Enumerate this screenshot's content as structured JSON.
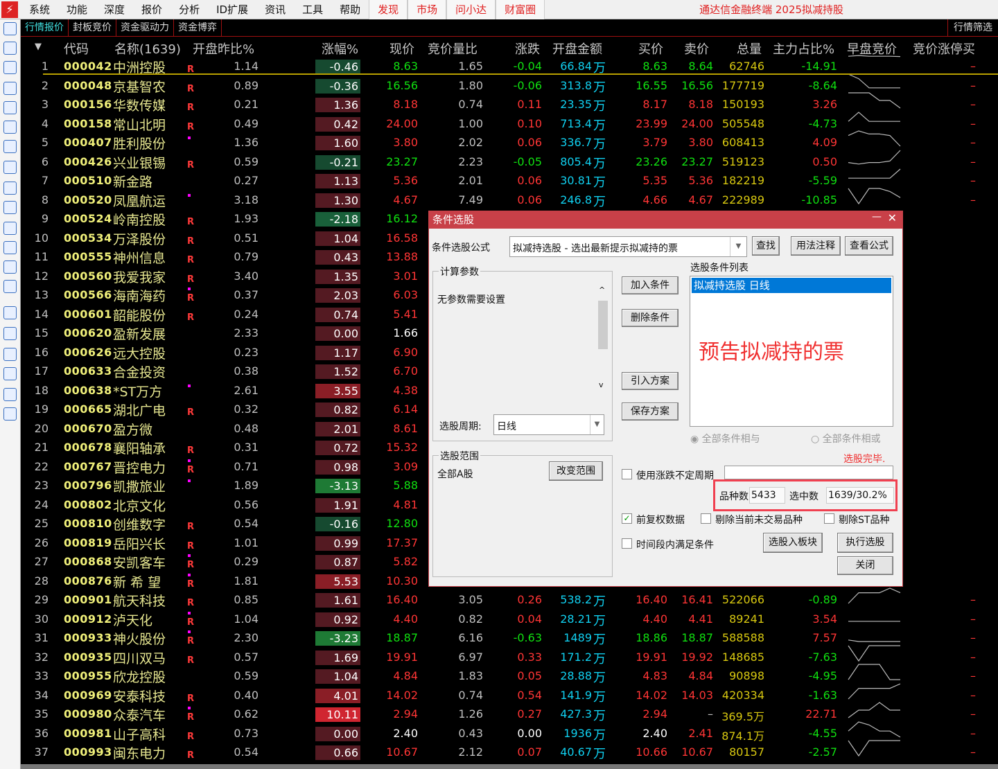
{
  "menubar": {
    "items": [
      "系统",
      "功能",
      "深度",
      "报价",
      "分析",
      "ID扩展",
      "资讯",
      "工具",
      "帮助"
    ],
    "right_items": [
      "发现",
      "市场",
      "问小达",
      "财富圈"
    ],
    "title": "通达信金融终端  2025拟减持股"
  },
  "tabs": {
    "items": [
      "行情报价",
      "封板竞价",
      "资金驱动力",
      "资金博弈"
    ],
    "filter": "行情筛选"
  },
  "toolbar_icons": [
    "back-arrow-icon",
    "up-arrow-icon",
    "down-arrow-icon",
    "quote-list-icon",
    "grid-icon",
    "line-chart-icon",
    "kline-icon",
    "report-icon",
    "f10-icon",
    "board-icon",
    "notes-icon",
    "f12-icon",
    "formula-icon",
    "circle-icon",
    "folder-icon",
    "sort-icon",
    "scatter-icon",
    "export-icon",
    "printer-icon",
    "gear-icon"
  ],
  "headers": [
    "代码",
    "名称(1639)",
    "开盘昨比%",
    "涨幅%",
    "现价",
    "竞价量比",
    "涨跌",
    "开盘金额",
    "买价",
    "卖价",
    "总量",
    "主力占比%",
    "早盘竞价",
    "竞价涨停买"
  ],
  "colors": {
    "up": "#ff3535",
    "down": "#10e010",
    "accent": "#c84048"
  },
  "rows": [
    [
      "1",
      "000042",
      "中洲控股",
      "R",
      "1.14",
      "-0.46",
      "8.63",
      "1.65",
      "-0.04",
      "66.84",
      "8.63",
      "8.64",
      "62746",
      "-14.91",
      [
        0.1,
        0.05,
        0.1,
        0.1,
        0.1,
        0.12
      ]
    ],
    [
      "2",
      "000048",
      "京基智农",
      "R",
      "0.89",
      "-0.36",
      "16.56",
      "1.80",
      "-0.06",
      "313.8",
      "16.55",
      "16.56",
      "177719",
      "-8.64",
      [
        0,
        0.3,
        0.9,
        0.9,
        0.9,
        0.9
      ]
    ],
    [
      "3",
      "000156",
      "华数传媒",
      "R",
      "0.21",
      "1.36",
      "8.18",
      "0.74",
      "0.11",
      "23.35",
      "8.17",
      "8.18",
      "150193",
      "3.26",
      [
        0,
        0,
        0,
        0.5,
        0.5,
        1
      ]
    ],
    [
      "4",
      "000158",
      "常山北明",
      "R",
      "0.49",
      "0.42",
      "24.00",
      "1.00",
      "0.10",
      "713.4",
      "23.99",
      "24.00",
      "505548",
      "-4.73",
      [
        0.6,
        0,
        0.6,
        0.6,
        0.6,
        0.6
      ]
    ],
    [
      "5",
      "000407",
      "胜利股份",
      "dot",
      "1.36",
      "1.60",
      "3.80",
      "2.02",
      "0.06",
      "336.7",
      "3.79",
      "3.80",
      "608413",
      "4.09",
      [
        0.3,
        0,
        0.2,
        0.2,
        0.3,
        1
      ]
    ],
    [
      "6",
      "000426",
      "兴业银锡",
      "R",
      "0.59",
      "-0.21",
      "23.27",
      "2.23",
      "-0.05",
      "805.4",
      "23.26",
      "23.27",
      "519123",
      "0.50",
      [
        0.8,
        0.9,
        0.8,
        0.8,
        0.7,
        0
      ]
    ],
    [
      "7",
      "000510",
      "新金路",
      "",
      "0.27",
      "1.13",
      "5.36",
      "2.01",
      "0.06",
      "30.81",
      "5.35",
      "5.36",
      "182219",
      "-5.59",
      [
        0.6,
        0.6,
        0.6,
        0.6,
        0.6,
        0
      ]
    ],
    [
      "8",
      "000520",
      "凤凰航运",
      "dot",
      "3.18",
      "1.30",
      "4.67",
      "7.49",
      "0.06",
      "246.8",
      "4.66",
      "4.67",
      "222989",
      "-10.85",
      [
        0,
        1,
        0,
        0,
        0.2,
        0.6
      ]
    ],
    [
      "9",
      "000524",
      "岭南控股",
      "R",
      "1.93",
      "-2.18",
      "16.12"
    ],
    [
      "10",
      "000534",
      "万泽股份",
      "R",
      "0.51",
      "1.04",
      "16.58"
    ],
    [
      "11",
      "000555",
      "神州信息",
      "R",
      "0.79",
      "0.43",
      "13.88"
    ],
    [
      "12",
      "000560",
      "我爱我家",
      "R",
      "3.40",
      "1.35",
      "3.01"
    ],
    [
      "13",
      "000566",
      "海南海药",
      "dotR",
      "0.37",
      "2.03",
      "6.03"
    ],
    [
      "14",
      "000601",
      "韶能股份",
      "R",
      "0.24",
      "0.74",
      "5.41"
    ],
    [
      "15",
      "000620",
      "盈新发展",
      "",
      "2.33",
      "0.00",
      "1.66"
    ],
    [
      "16",
      "000626",
      "远大控股",
      "",
      "0.23",
      "1.17",
      "6.90"
    ],
    [
      "17",
      "000633",
      "合金投资",
      "",
      "0.38",
      "1.52",
      "6.70"
    ],
    [
      "18",
      "000638",
      "*ST万方",
      "dot",
      "2.61",
      "3.55",
      "4.38"
    ],
    [
      "19",
      "000665",
      "湖北广电",
      "R",
      "0.32",
      "0.82",
      "6.14"
    ],
    [
      "20",
      "000670",
      "盈方微",
      "",
      "0.48",
      "2.01",
      "8.61"
    ],
    [
      "21",
      "000678",
      "襄阳轴承",
      "R",
      "0.31",
      "0.72",
      "15.32"
    ],
    [
      "22",
      "000767",
      "晋控电力",
      "dotR",
      "0.71",
      "0.98",
      "3.09"
    ],
    [
      "23",
      "000796",
      "凯撒旅业",
      "dot",
      "1.89",
      "-3.13",
      "5.88"
    ],
    [
      "24",
      "000802",
      "北京文化",
      "",
      "0.56",
      "1.91",
      "4.81"
    ],
    [
      "25",
      "000810",
      "创维数字",
      "R",
      "0.54",
      "-0.16",
      "12.80"
    ],
    [
      "26",
      "000819",
      "岳阳兴长",
      "R",
      "1.01",
      "0.99",
      "17.37"
    ],
    [
      "27",
      "000868",
      "安凯客车",
      "dotR",
      "0.29",
      "0.87",
      "5.82"
    ],
    [
      "28",
      "000876",
      "新 希 望",
      "dotR",
      "1.81",
      "5.53",
      "10.30"
    ],
    [
      "29",
      "000901",
      "航天科技",
      "R",
      "0.85",
      "1.61",
      "16.40",
      "3.05",
      "0.26",
      "538.2",
      "16.40",
      "16.41",
      "522066",
      "-0.89",
      [
        1,
        0.3,
        0.3,
        0.3,
        0,
        0.3
      ]
    ],
    [
      "30",
      "000912",
      "泸天化",
      "dotR",
      "1.04",
      "0.92",
      "4.40",
      "0.82",
      "0.04",
      "28.21",
      "4.40",
      "4.41",
      "89241",
      "3.54",
      [
        0.9,
        0.9,
        0.9,
        0.9,
        0.9,
        0.9
      ]
    ],
    [
      "31",
      "000933",
      "神火股份",
      "dotR",
      "2.30",
      "-3.23",
      "18.87",
      "6.16",
      "-0.63",
      "1489",
      "18.86",
      "18.87",
      "588588",
      "7.57",
      [
        0.9,
        1,
        1,
        1,
        1,
        1
      ]
    ],
    [
      "32",
      "000935",
      "四川双马",
      "R",
      "0.57",
      "1.69",
      "19.91",
      "6.97",
      "0.33",
      "171.2",
      "19.91",
      "19.92",
      "148685",
      "-7.63",
      [
        0,
        1,
        0,
        0,
        0,
        0
      ]
    ],
    [
      "33",
      "000955",
      "欣龙控股",
      "",
      "0.59",
      "1.04",
      "4.84",
      "1.83",
      "0.05",
      "28.88",
      "4.83",
      "4.84",
      "90898",
      "-4.95",
      [
        1,
        0,
        0,
        0,
        1,
        1
      ]
    ],
    [
      "34",
      "000969",
      "安泰科技",
      "R",
      "0.40",
      "4.01",
      "14.02",
      "0.74",
      "0.54",
      "141.9",
      "14.02",
      "14.03",
      "420334",
      "-1.63",
      [
        1,
        0.3,
        0.3,
        0.3,
        0.3,
        0
      ]
    ],
    [
      "35",
      "000980",
      "众泰汽车",
      "dotR",
      "0.62",
      "10.11",
      "2.94",
      "1.26",
      "0.27",
      "427.3",
      "2.94",
      "–",
      "369.5万",
      "22.71",
      [
        1,
        0.5,
        0.5,
        0,
        0.5,
        0.5
      ]
    ],
    [
      "36",
      "000981",
      "山子高科",
      "R",
      "0.73",
      "0.00",
      "2.40",
      "0.43",
      "0.00",
      "1936",
      "2.40",
      "2.41",
      "874.1万",
      "-4.55",
      [
        0.6,
        0,
        0.2,
        0.6,
        0.6,
        1
      ]
    ],
    [
      "37",
      "000993",
      "闽东电力",
      "R",
      "0.54",
      "0.66",
      "10.67",
      "2.12",
      "0.07",
      "40.67",
      "10.66",
      "10.67",
      "80157",
      "-2.57",
      [
        0,
        1,
        0,
        0,
        0,
        0
      ]
    ]
  ],
  "wan": "万",
  "limit_buy": "–",
  "dialog": {
    "title": "条件选股",
    "formula_label": "条件选股公式",
    "formula_value": "拟减持选股  -  选出最新提示拟减持的票",
    "btn_find": "查找",
    "btn_usage": "用法注释",
    "btn_view": "查看公式",
    "params_label": "计算参数",
    "params_text": "无参数需要设置",
    "period_label": "选股周期:",
    "period_value": "日线",
    "scope_label": "选股范围",
    "scope_value": "全部A股",
    "btn_scope": "改变范围",
    "btn_add": "加入条件",
    "btn_delete": "删除条件",
    "btn_import": "引入方案",
    "btn_save": "保存方案",
    "list_label": "选股条件列表",
    "list_item": "拟减持选股  日线",
    "annotation": "预告拟减持的票",
    "radio_and": "全部条件相与",
    "radio_or": "全部条件相或",
    "status": "选股完毕.",
    "cb_period": "使用涨跌不定周期",
    "count_label": "品种数",
    "count_value": "5433",
    "selected_label": "选中数",
    "selected_value": "1639/30.2%",
    "cb_adjust": "前复权数据",
    "cb_exclude_untraded": "剔除当前未交易品种",
    "cb_exclude_st": "剔除ST品种",
    "cb_timerange": "时间段内满足条件",
    "btn_to_block": "选股入板块",
    "btn_execute": "执行选股",
    "btn_close": "关闭"
  }
}
